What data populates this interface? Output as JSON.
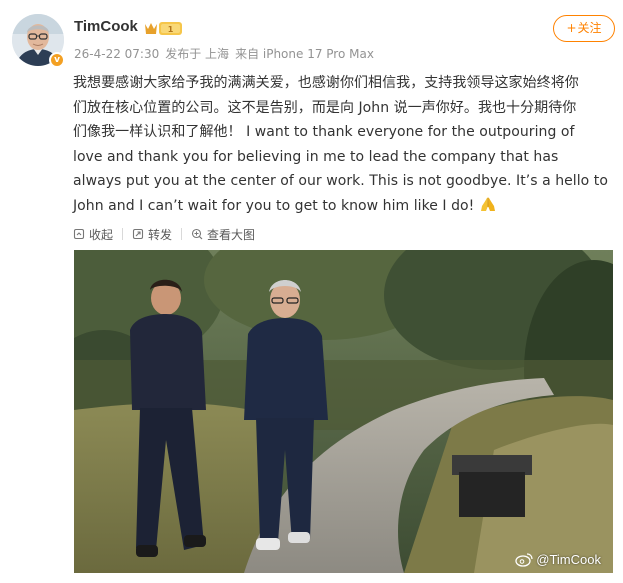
{
  "post": {
    "username": "TimCook",
    "vip_badge": "1",
    "timestamp": "26-4-22 07:30",
    "location": "发布于 上海",
    "source": "来自 iPhone 17 Pro Max",
    "follow_label": "关注",
    "follow_plus": "+",
    "text_lines": [
      "我想要感谢大家给予我的满满关爱，也感谢你们相信我，支持我领导这家始终将你",
      "们放在核心位置的公司。这不是告别，而是向 John 说一声你好。我也十分期待你",
      "们像我一样认识和了解他！ I want to thank everyone for the outpouring of",
      "love and thank you for believing in me to lead the company that has",
      "always put you at the center of our work. This is not goodbye. It’s a hello to",
      "John and I can’t wait for you to get to know him like I do!"
    ],
    "emoji": "pray-emoji"
  },
  "actions": {
    "collapse": "收起",
    "repost": "转发",
    "view_large": "查看大图"
  },
  "photo": {
    "watermark": "@TimCook"
  },
  "colors": {
    "accent": "#ff8200",
    "meta": "#939393",
    "text": "#333333"
  }
}
